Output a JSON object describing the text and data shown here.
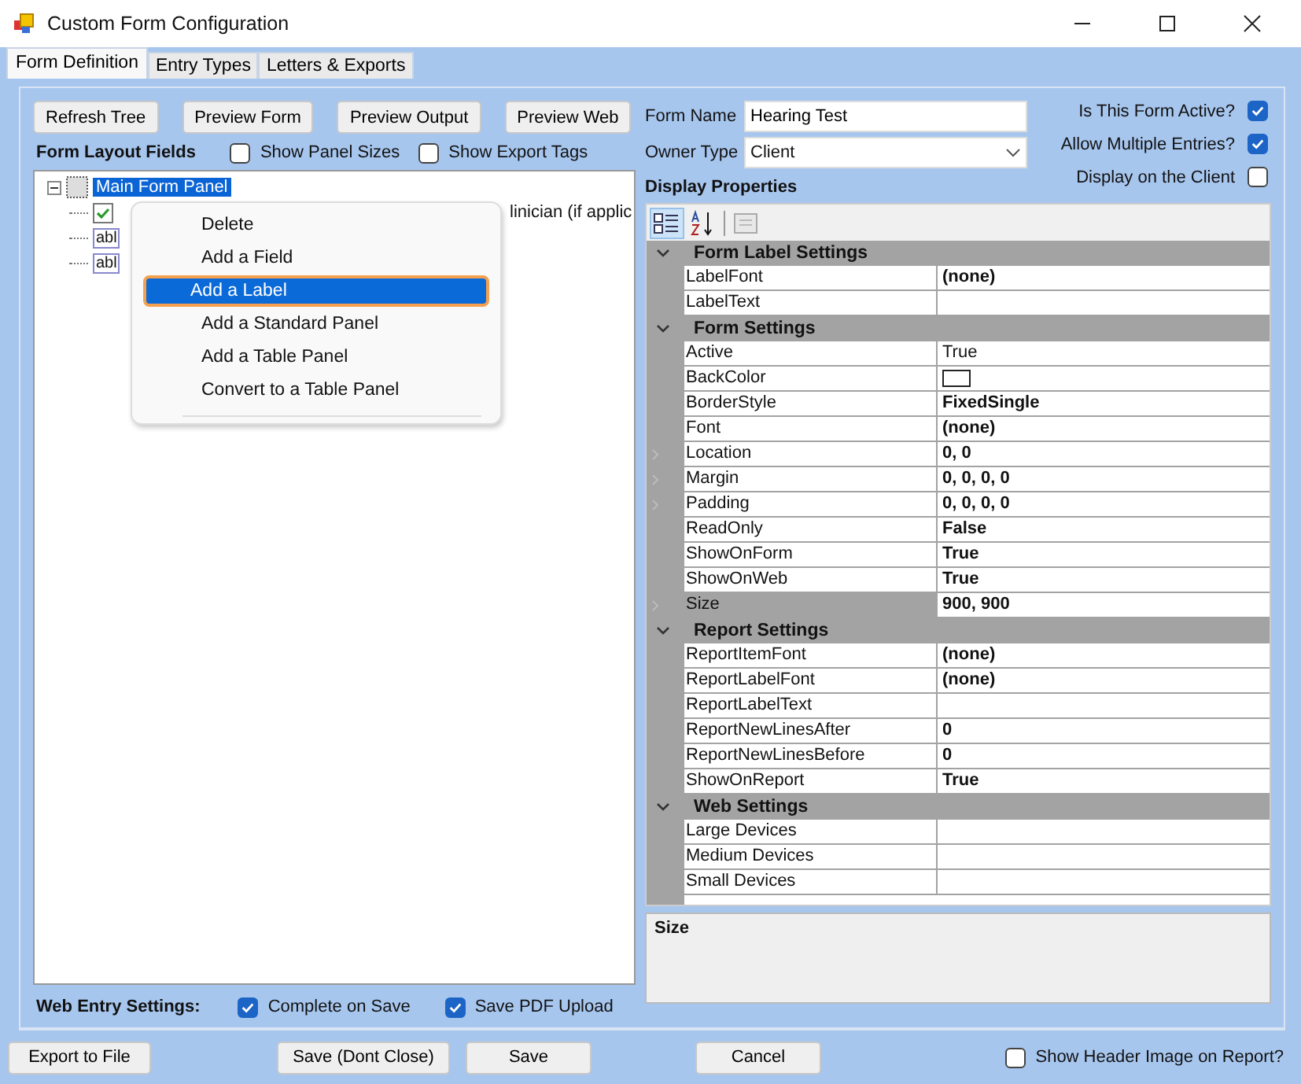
{
  "window": {
    "title": "Custom Form Configuration"
  },
  "tabs": [
    {
      "label": "Form Definition",
      "selected": true
    },
    {
      "label": "Entry Types",
      "selected": false
    },
    {
      "label": "Letters & Exports",
      "selected": false
    }
  ],
  "toolbar_buttons": [
    "Refresh Tree",
    "Preview Form",
    "Preview Output",
    "Preview Web"
  ],
  "layout_section": {
    "title": "Form Layout Fields",
    "options": [
      {
        "label": "Show Panel Sizes",
        "checked": false
      },
      {
        "label": "Show Export Tags",
        "checked": false
      }
    ]
  },
  "tree": {
    "root": {
      "label": "Main Form Panel",
      "selected": true,
      "expanded": true,
      "children": [
        {
          "kind": "checkbox",
          "label": "linician (if applic"
        },
        {
          "kind": "textbox",
          "icon_label": "abl"
        },
        {
          "kind": "textbox",
          "icon_label": "abl"
        }
      ]
    }
  },
  "context_menu": [
    {
      "label": "Delete",
      "selected": false
    },
    {
      "label": "Add a Field",
      "selected": false
    },
    {
      "label": "Add a Label",
      "selected": true
    },
    {
      "label": "Add a Standard Panel",
      "selected": false
    },
    {
      "label": "Add a Table Panel",
      "selected": false
    },
    {
      "label": "Convert to a Table Panel",
      "selected": false
    }
  ],
  "web_entry_settings": {
    "title": "Web Entry Settings:",
    "options": [
      {
        "label": "Complete on Save",
        "checked": true
      },
      {
        "label": "Save PDF Upload",
        "checked": true
      }
    ]
  },
  "form_name": {
    "label": "Form Name",
    "value": "Hearing Test"
  },
  "owner_type": {
    "label": "Owner Type",
    "value": "Client"
  },
  "flags": [
    {
      "label": "Is This Form Active?",
      "checked": true
    },
    {
      "label": "Allow Multiple Entries?",
      "checked": true
    },
    {
      "label": "Display on the Client",
      "checked": false
    }
  ],
  "display_properties": {
    "title": "Display Properties",
    "categories": [
      {
        "name": "Form Label Settings",
        "expanded": true,
        "rows": [
          {
            "name": "LabelFont",
            "value": "(none)",
            "bold": true,
            "expandable": false,
            "selected": false
          },
          {
            "name": "LabelText",
            "expandable": false,
            "selected": false
          }
        ]
      },
      {
        "name": "Form Settings",
        "expanded": true,
        "rows": [
          {
            "name": "Active",
            "value": "True",
            "bold": false,
            "expandable": false,
            "selected": false
          },
          {
            "name": "BackColor",
            "kind": "color",
            "expandable": false,
            "selected": false
          },
          {
            "name": "BorderStyle",
            "value": "FixedSingle",
            "bold": true,
            "expandable": false,
            "selected": false
          },
          {
            "name": "Font",
            "value": "(none)",
            "bold": true,
            "expandable": false,
            "selected": false
          },
          {
            "name": "Location",
            "value": "0, 0",
            "bold": true,
            "expandable": true,
            "selected": false
          },
          {
            "name": "Margin",
            "value": "0, 0, 0, 0",
            "bold": true,
            "expandable": true,
            "selected": false
          },
          {
            "name": "Padding",
            "value": "0, 0, 0, 0",
            "bold": true,
            "expandable": true,
            "selected": false
          },
          {
            "name": "ReadOnly",
            "value": "False",
            "bold": true,
            "expandable": false,
            "selected": false
          },
          {
            "name": "ShowOnForm",
            "value": "True",
            "bold": true,
            "expandable": false,
            "selected": false
          },
          {
            "name": "ShowOnWeb",
            "value": "True",
            "bold": true,
            "expandable": false,
            "selected": false
          },
          {
            "name": "Size",
            "value": "900, 900",
            "bold": true,
            "expandable": true,
            "selected": true
          }
        ]
      },
      {
        "name": "Report Settings",
        "expanded": true,
        "rows": [
          {
            "name": "ReportItemFont",
            "value": "(none)",
            "bold": true,
            "expandable": false,
            "selected": false
          },
          {
            "name": "ReportLabelFont",
            "value": "(none)",
            "bold": true,
            "expandable": false,
            "selected": false
          },
          {
            "name": "ReportLabelText",
            "expandable": false,
            "selected": false
          },
          {
            "name": "ReportNewLinesAfter",
            "value": "0",
            "bold": true,
            "expandable": false,
            "selected": false
          },
          {
            "name": "ReportNewLinesBefore",
            "value": "0",
            "bold": true,
            "expandable": false,
            "selected": false
          },
          {
            "name": "ShowOnReport",
            "value": "True",
            "bold": true,
            "expandable": false,
            "selected": false
          }
        ]
      },
      {
        "name": "Web Settings",
        "expanded": true,
        "rows": [
          {
            "name": "Large Devices",
            "expandable": false,
            "selected": false
          },
          {
            "name": "Medium Devices",
            "expandable": false,
            "selected": false
          },
          {
            "name": "Small Devices",
            "expandable": false,
            "selected": false
          }
        ]
      }
    ],
    "description": "Size"
  },
  "footer_buttons": [
    "Export to File",
    "Save (Dont Close)",
    "Save",
    "Cancel"
  ],
  "header_image_option": {
    "label": "Show Header Image on Report?",
    "checked": false
  }
}
